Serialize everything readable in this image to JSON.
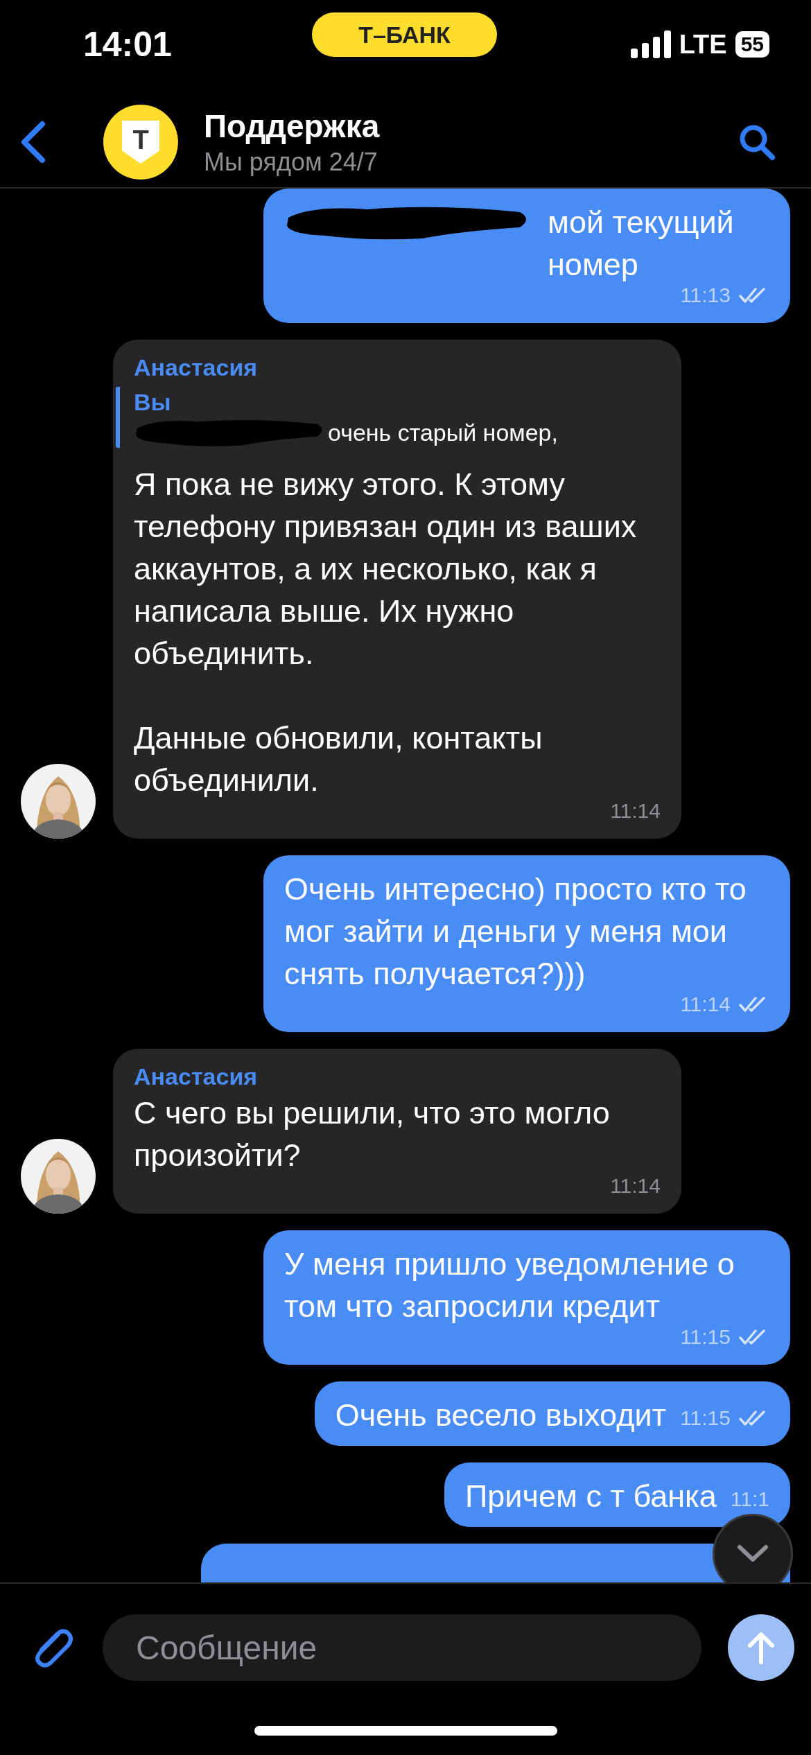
{
  "status_bar": {
    "time": "14:01",
    "carrier_pill": "Т–БАНК",
    "network": "LTE",
    "battery": "55"
  },
  "header": {
    "logo_letter": "Т",
    "title": "Поддержка",
    "subtitle": "Мы рядом 24/7"
  },
  "messages": [
    {
      "kind": "outgoing",
      "redacted": true,
      "text": "мой текущий номер",
      "time": "11:13",
      "read": true
    },
    {
      "kind": "incoming",
      "sender": "Анастасия",
      "reply": {
        "author": "Вы",
        "text": "очень старый номер,",
        "redacted": true
      },
      "text": "Я пока не вижу этого. К этому телефону привязан один из ваших аккаунтов, а их несколько, как я написала выше. Их нужно объединить.\n\nДанные обновили, контакты объединили.",
      "time": "11:14",
      "avatar": true
    },
    {
      "kind": "outgoing",
      "redacted": false,
      "text": "Очень интересно) просто кто то мог зайти и деньги у меня мои снять получается?)))",
      "time": "11:14",
      "read": true
    },
    {
      "kind": "incoming",
      "sender": "Анастасия",
      "text": "С чего вы решили, что это могло произойти?",
      "time": "11:14",
      "avatar": true
    },
    {
      "kind": "outgoing",
      "redacted": false,
      "text": "У меня пришло уведомление о том что запросили кредит",
      "time": "11:15",
      "read": true
    },
    {
      "kind": "outgoing",
      "redacted": false,
      "text": "Очень весело выходит",
      "time": "11:15",
      "read": true
    },
    {
      "kind": "outgoing",
      "redacted": false,
      "text": "Причем с т банка",
      "time": "11:1",
      "read": false
    },
    {
      "kind": "cut"
    }
  ],
  "composer": {
    "placeholder": "Сообщение"
  }
}
